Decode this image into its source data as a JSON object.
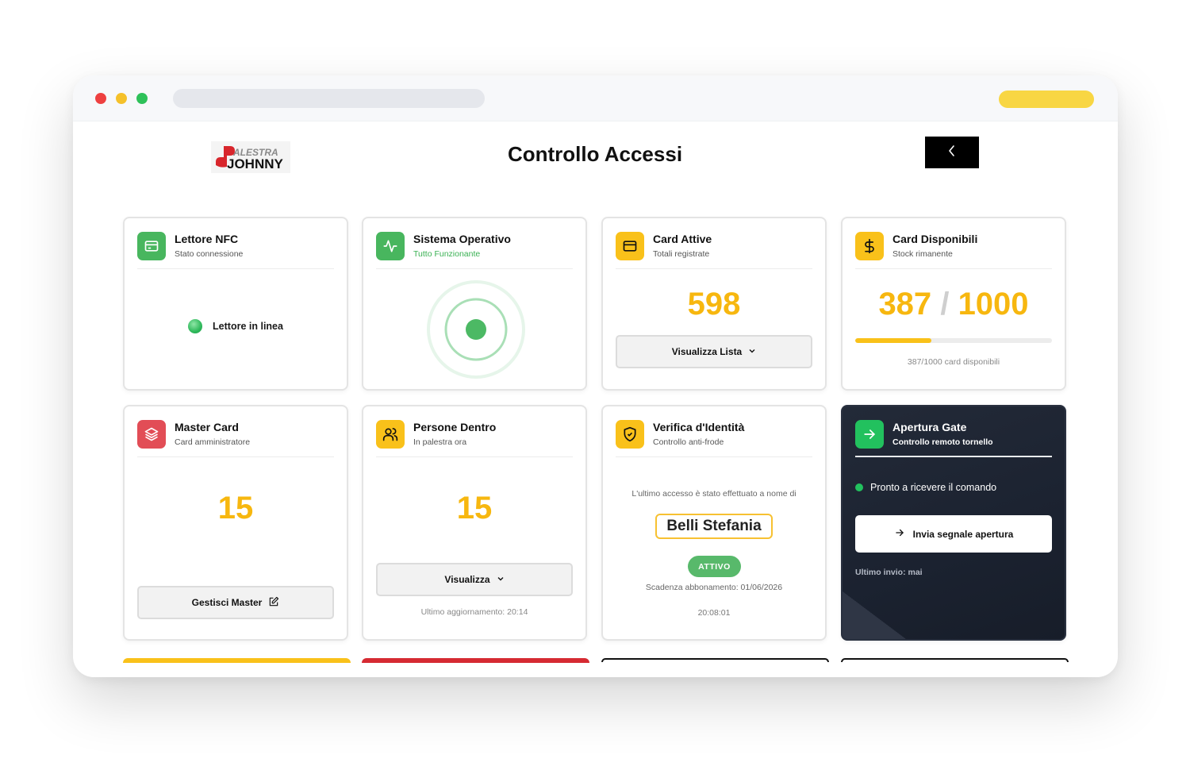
{
  "app": {
    "title": "Controllo Accessi",
    "logo_text": "PALESTRA JOHNNY"
  },
  "cards": {
    "nfc": {
      "title": "Lettore NFC",
      "subtitle": "Stato connessione",
      "status": "Lettore in linea",
      "icon": "credit-card-icon"
    },
    "system": {
      "title": "Sistema Operativo",
      "subtitle": "Tutto Funzionante",
      "icon": "activity-icon"
    },
    "active_cards": {
      "title": "Card Attive",
      "subtitle": "Totali registrate",
      "value": "598",
      "button_label": "Visualizza Lista",
      "icon": "credit-card-icon"
    },
    "available_cards": {
      "title": "Card Disponibili",
      "subtitle": "Stock rimanente",
      "available": "387",
      "separator": "/",
      "total": "1000",
      "progress_fraction": 0.387,
      "caption": "387/1000 card disponibili",
      "icon": "dollar-icon"
    },
    "master": {
      "title": "Master Card",
      "subtitle": "Card amministratore",
      "value": "15",
      "button_label": "Gestisci Master",
      "icon": "layers-icon"
    },
    "people": {
      "title": "Persone Dentro",
      "subtitle": "In palestra ora",
      "value": "15",
      "button_label": "Visualizza",
      "updated": "Ultimo aggiornamento: 20:14",
      "icon": "users-icon"
    },
    "identity": {
      "title": "Verifica d'Identità",
      "subtitle": "Controllo anti-frode",
      "intro": "L'ultimo accesso è stato effettuato a nome di",
      "name": "Belli Stefania",
      "badge": "ATTIVO",
      "expiry": "Scadenza abbonamento: 01/06/2026",
      "time": "20:08:01",
      "icon": "shield-icon"
    },
    "gate": {
      "title": "Apertura Gate",
      "subtitle": "Controllo remoto tornello",
      "status": "Pronto a ricevere il comando",
      "button_label": "Invia segnale apertura",
      "last_sent": "Ultimo invio: mai",
      "icon": "arrow-right-icon"
    }
  },
  "colors": {
    "accent_yellow": "#f7b70f",
    "ok_green": "#48b65e",
    "danger_red": "#e24d56",
    "dark_card": "#1b2230"
  }
}
